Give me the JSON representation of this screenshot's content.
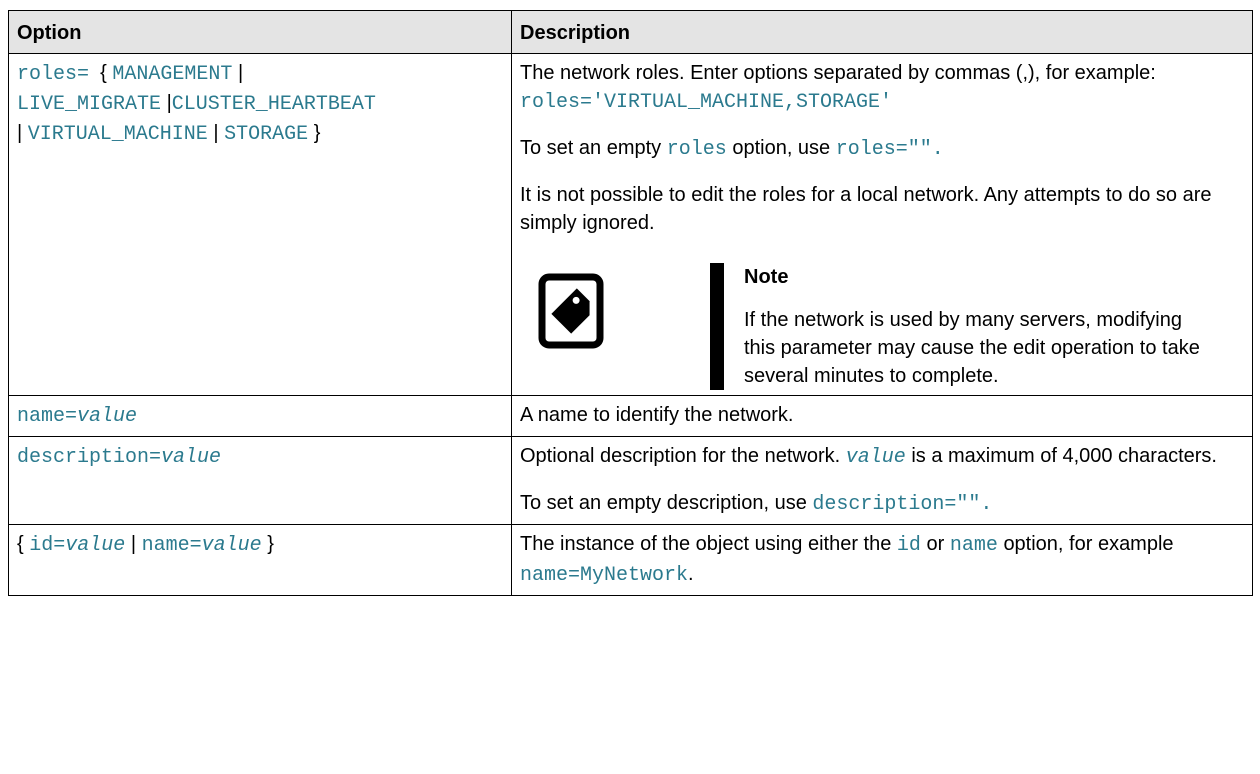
{
  "headers": {
    "option": "Option",
    "description": "Description"
  },
  "rows": {
    "roles": {
      "opt": {
        "prefix": "roles=",
        "open": "{",
        "values": [
          "MANAGEMENT",
          "LIVE_MIGRATE",
          "CLUSTER_HEARTBEAT",
          "VIRTUAL_MACHINE",
          "STORAGE"
        ],
        "sep": "|",
        "close": "}"
      },
      "desc1": "The network roles. Enter options separated by commas (,), for example:",
      "code1": "roles='VIRTUAL_MACHINE,STORAGE'",
      "desc2_pre": "To set an empty",
      "desc2_code": "roles",
      "desc2_mid": "option, use",
      "desc2_code2": "roles=\"\".",
      "desc3": "It is not possible to edit the roles for a local network. Any attempts to do so are simply ignored.",
      "note_icon": "note-tag-icon",
      "note_title": "Note",
      "note_text": "If the network is used by many servers, modifying this parameter may cause the edit operation to take several minutes to complete."
    },
    "name": {
      "opt_code": "name=",
      "opt_var": "value",
      "desc": "A name to identify the network."
    },
    "description": {
      "opt_code": "description=",
      "opt_var": "value",
      "desc_pre": "Optional description for the network.",
      "desc_var": "value",
      "desc_post": "is a maximum of 4,000 characters.",
      "desc2_pre": "To set an empty description, use",
      "desc2_code": "description=\"\"."
    },
    "id": {
      "open": "{",
      "code1": "id=",
      "var1": "value",
      "sep": "|",
      "code2": "name=",
      "var2": "value",
      "close": "}",
      "desc_pre": "The instance of the object using either the",
      "desc_code1": "id",
      "desc_or": "or",
      "desc_code2": "name",
      "desc_mid": "option, for example",
      "desc_code3": "name=MyNetwork",
      "desc_end": "."
    }
  }
}
